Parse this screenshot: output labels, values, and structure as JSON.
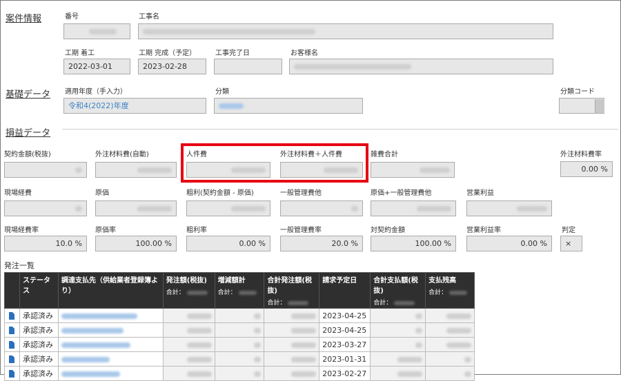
{
  "sections": {
    "case_info": "案件情報",
    "basic_data": "基礎データ",
    "profit_data": "損益データ",
    "order_list": "発注一覧"
  },
  "case_info": {
    "number_label": "番号",
    "work_name_label": "工事名",
    "period_start_label": "工期 着工",
    "period_end_label": "工期 完成（予定）",
    "work_done_date_label": "工事完了日",
    "customer_label": "お客様名",
    "period_start": "2022-03-01",
    "period_end": "2023-02-28",
    "work_done_date": ""
  },
  "basic_data": {
    "fiscal_year_label": "適用年度（手入力）",
    "fiscal_year_value": "令和4(2022)年度",
    "category_label": "分類",
    "category_code_label": "分類コード"
  },
  "profit": {
    "contract_amount_label": "契約金額(税抜)",
    "outsource_auto_label": "外注材料費(自動)",
    "labor_label": "人件費",
    "outsource_labor_label": "外注材料費＋人件費",
    "misc_total_label": "雑費合計",
    "outsource_rate_label": "外注材料費率",
    "outsource_rate_value": "0.00 %",
    "site_cost_label": "現場経費",
    "cost_label": "原価",
    "gross_profit_label": "粗利(契約金額 - 原価)",
    "general_mgmt_label": "一般管理費他",
    "cost_plus_mgmt_label": "原価+一般管理費他",
    "operating_profit_label": "営業利益",
    "site_cost_rate_label": "現場経費率",
    "site_cost_rate_value": "10.0 %",
    "cost_rate_label": "原価率",
    "cost_rate_value": "100.00 %",
    "gross_rate_label": "粗利率",
    "gross_rate_value": "0.00 %",
    "general_mgmt_rate_label": "一般管理費率",
    "general_mgmt_rate_value": "20.0 %",
    "vs_contract_label": "対契約金額",
    "vs_contract_value": "100.00 %",
    "operating_rate_label": "営業利益率",
    "operating_rate_value": "0.00 %",
    "judgement_label": "判定",
    "judgement_value": "×"
  },
  "order_table": {
    "headers": {
      "status": "ステータス",
      "supplier": "調達支払先（供給業者登録簿より）",
      "order_amount": "発注額(税抜)",
      "adjust_total": "増減額計",
      "total_order": "合計発注額(税抜)",
      "billing_date": "請求予定日",
      "total_paid": "合計支払額(税抜)",
      "balance": "支払残高",
      "sum_label": "合計："
    },
    "rows": [
      {
        "status": "承認済み",
        "billing_date": "2023-04-25"
      },
      {
        "status": "承認済み",
        "billing_date": "2023-04-25"
      },
      {
        "status": "承認済み",
        "billing_date": "2023-03-27"
      },
      {
        "status": "承認済み",
        "billing_date": "2023-01-31"
      },
      {
        "status": "承認済み",
        "billing_date": "2023-02-27"
      }
    ]
  }
}
